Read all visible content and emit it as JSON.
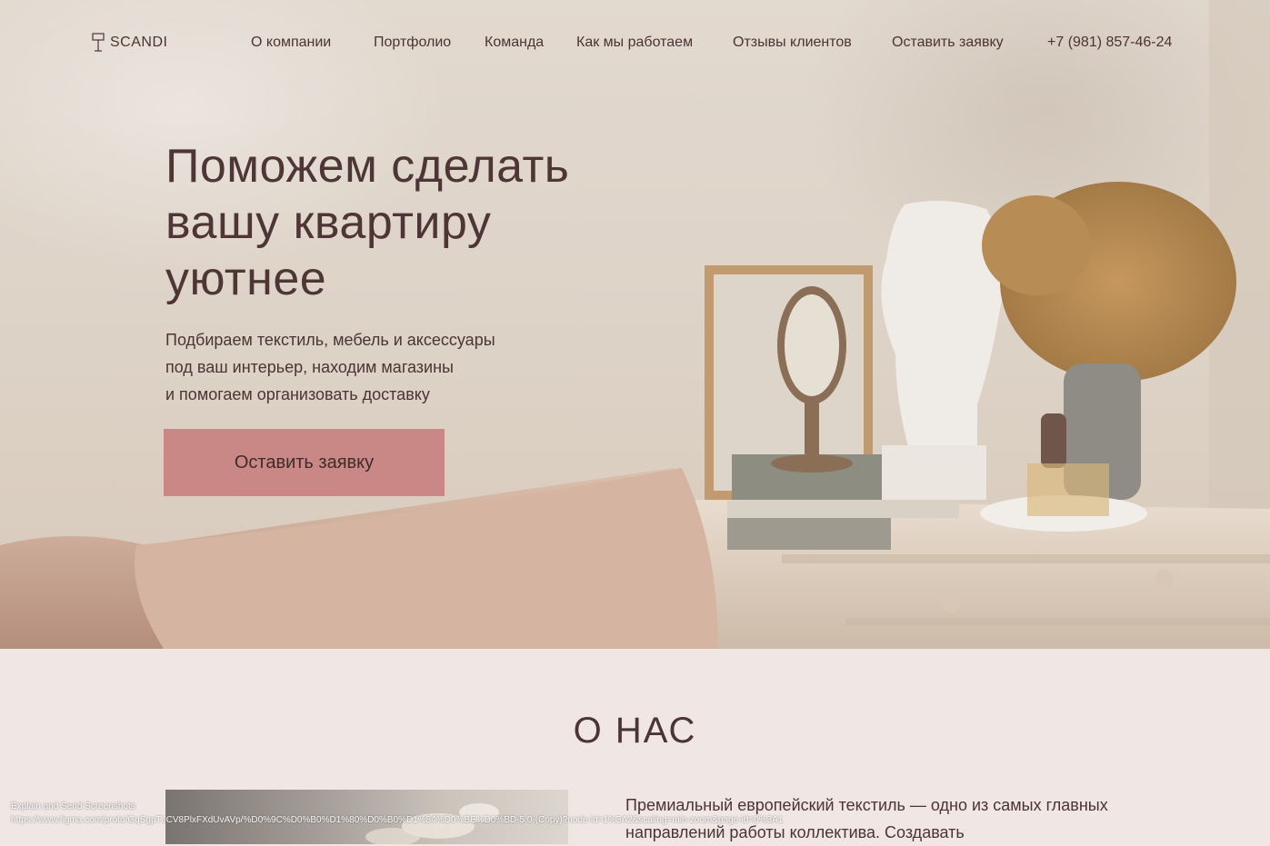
{
  "brand": {
    "name": "SCANDI"
  },
  "nav": {
    "links": [
      "О компании",
      "Портфолио",
      "Команда",
      "Как мы работаем",
      "Отзывы клиентов",
      "Оставить заявку"
    ],
    "phone": "+7 (981) 857-46-24"
  },
  "hero": {
    "headline": "Поможем сделать вашу квартиру уютнее",
    "subtext": [
      "Подбираем текстиль, мебель и аксессуары",
      "под ваш интерьер, находим магазины",
      "и помогаем организовать доставку"
    ],
    "cta_label": "Оставить заявку"
  },
  "about": {
    "title": "О НАС",
    "text": "Премиальный европейский текстиль — одно из самых главных направлений работы коллектива. Создавать"
  },
  "overlay": {
    "label": "Explain and Send Screenshots",
    "url": "https://www.figma.com/proto/GqSgpTJCV8PlxFXdUvAVp/%D0%9C%D0%B0%D1%80%D0%B0%D1%84%D0%BE%D0%BD-5.0-(Copy)?node-id=1%3A2&scaling=min-zoom&page-id=0%3A1"
  },
  "colors": {
    "accent": "#c98886",
    "text": "#4b3434",
    "section_bg": "#f0e6e3"
  },
  "icons": {
    "logo": "lamp-icon"
  }
}
